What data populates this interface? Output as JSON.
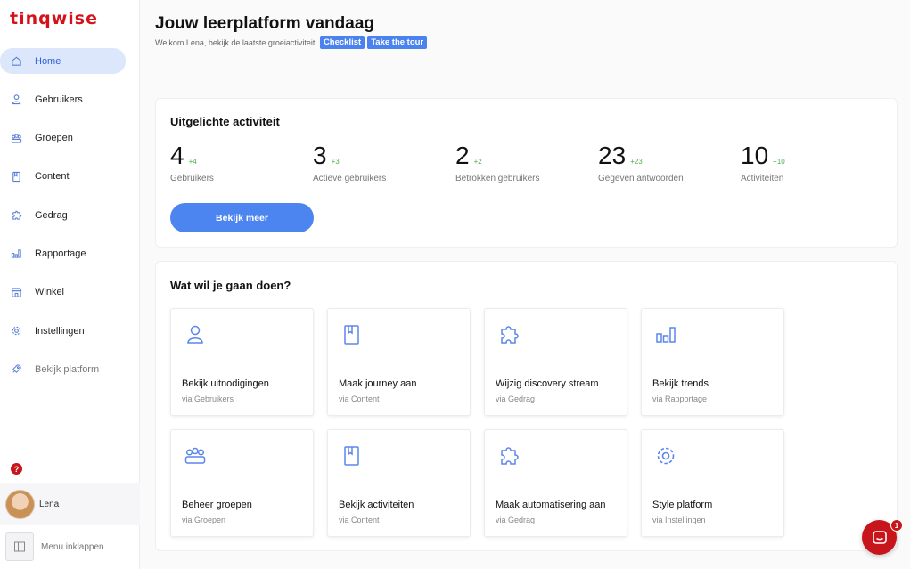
{
  "brand": {
    "logo_text": "tinqwise",
    "accent": "#d5121b",
    "primary": "#4d85f0"
  },
  "sidebar": {
    "items": [
      {
        "label": "Home",
        "icon": "home-icon",
        "active": true
      },
      {
        "label": "Gebruikers",
        "icon": "user-icon"
      },
      {
        "label": "Groepen",
        "icon": "group-icon"
      },
      {
        "label": "Content",
        "icon": "document-icon"
      },
      {
        "label": "Gedrag",
        "icon": "puzzle-icon"
      },
      {
        "label": "Rapportage",
        "icon": "bar-chart-icon"
      },
      {
        "label": "Winkel",
        "icon": "shop-icon"
      },
      {
        "label": "Instellingen",
        "icon": "gear-icon"
      },
      {
        "label": "Bekijk platform",
        "icon": "rocket-icon",
        "muted": true
      }
    ],
    "help_badge": "?",
    "user_name": "Lena",
    "collapse_label": "Menu inklappen"
  },
  "header": {
    "title": "Jouw leerplatform vandaag",
    "subtitle": "Welkom Lena, bekijk de laatste groeiactiviteit.",
    "checklist_label": "Checklist",
    "tour_label": "Take the tour"
  },
  "featured": {
    "title": "Uitgelichte activiteit",
    "stats": [
      {
        "value": "4",
        "delta": "+4",
        "label": "Gebruikers"
      },
      {
        "value": "3",
        "delta": "+3",
        "label": "Actieve gebruikers"
      },
      {
        "value": "2",
        "delta": "+2",
        "label": "Betrokken gebruikers"
      },
      {
        "value": "23",
        "delta": "+23",
        "label": "Gegeven antwoorden"
      },
      {
        "value": "10",
        "delta": "+10",
        "label": "Activiteiten"
      }
    ],
    "more_label": "Bekijk meer"
  },
  "actions": {
    "title": "Wat wil je gaan doen?",
    "tiles": [
      {
        "title": "Bekijk uitnodigingen",
        "sub": "via Gebruikers",
        "icon": "user-icon"
      },
      {
        "title": "Maak journey aan",
        "sub": "via Content",
        "icon": "document-icon"
      },
      {
        "title": "Wijzig discovery stream",
        "sub": "via Gedrag",
        "icon": "puzzle-icon"
      },
      {
        "title": "Bekijk trends",
        "sub": "via Rapportage",
        "icon": "bar-chart-icon"
      },
      {
        "title": "Beheer groepen",
        "sub": "via Groepen",
        "icon": "group-icon"
      },
      {
        "title": "Bekijk activiteiten",
        "sub": "via Content",
        "icon": "document-icon"
      },
      {
        "title": "Maak automatisering aan",
        "sub": "via Gedrag",
        "icon": "puzzle-icon"
      },
      {
        "title": "Style platform",
        "sub": "via Instellingen",
        "icon": "gear-icon"
      }
    ]
  },
  "chat": {
    "badge": "1"
  }
}
